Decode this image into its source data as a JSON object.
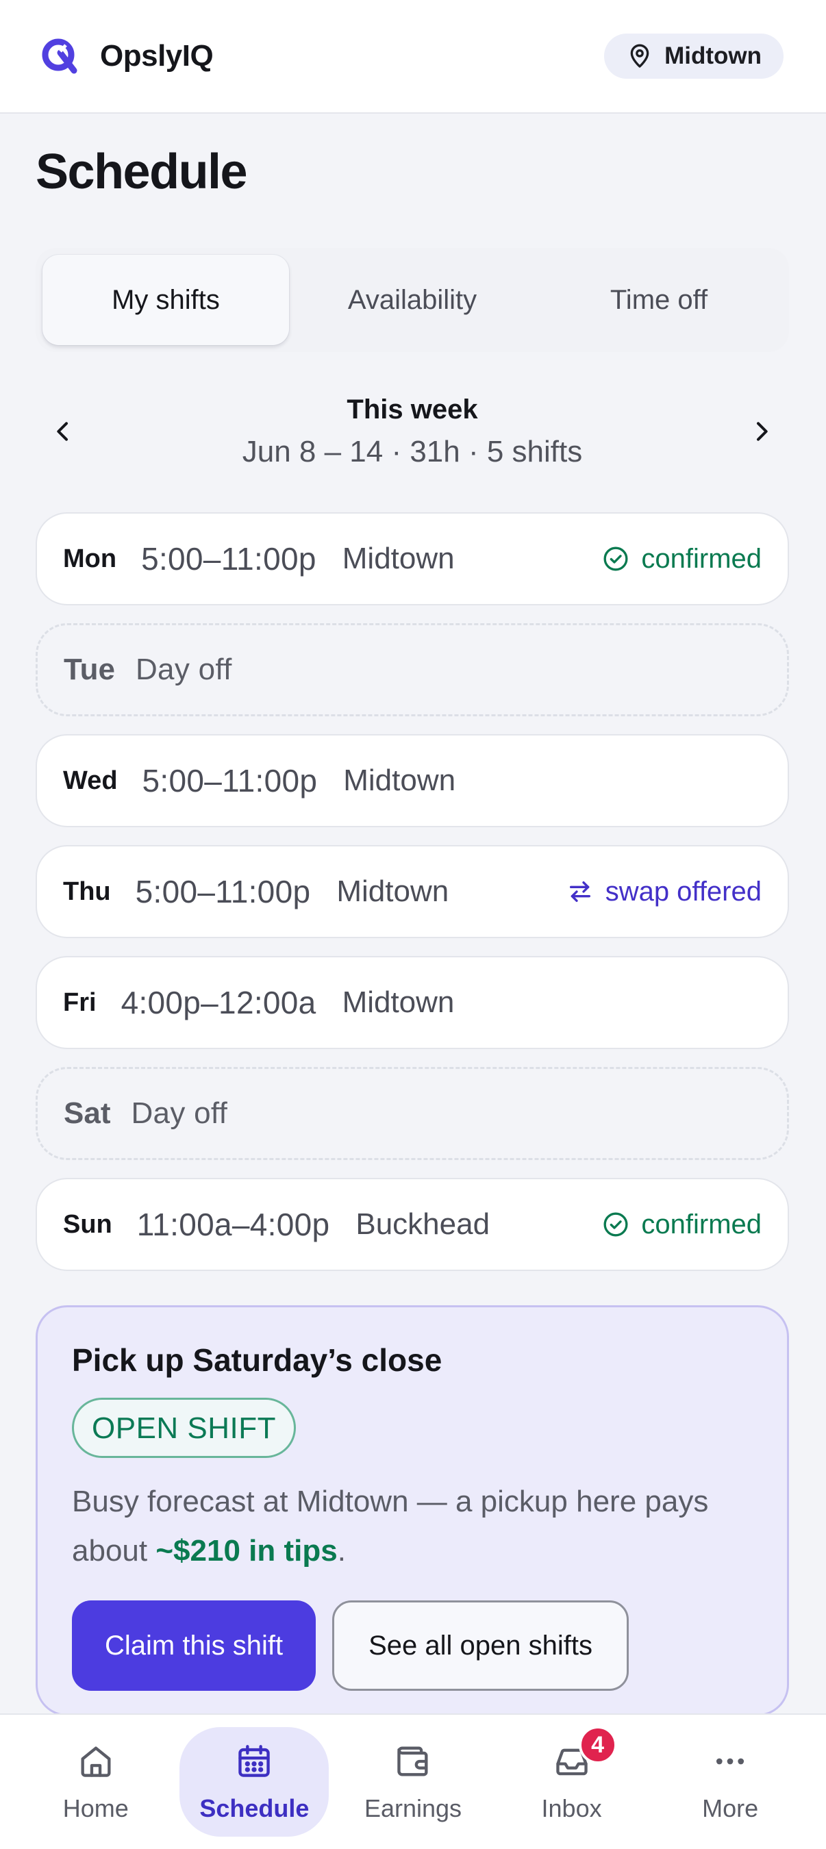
{
  "app": {
    "brand_name": "OpslyIQ",
    "location": "Midtown",
    "accent": "#4c3ce0"
  },
  "page": {
    "title": "Schedule"
  },
  "tabs": [
    {
      "label": "My shifts",
      "active": true
    },
    {
      "label": "Availability",
      "active": false
    },
    {
      "label": "Time off",
      "active": false
    }
  ],
  "week": {
    "title": "This week",
    "summary": "Jun 8 – 14 · 31h · 5 shifts",
    "prev_icon": "chevron-left-icon",
    "next_icon": "chevron-right-icon"
  },
  "shifts": [
    {
      "day": "Mon",
      "time": "5:00–11:00p",
      "location": "Midtown",
      "status": "confirmed",
      "status_icon": "check-circle-icon",
      "status_color": "#0a7a50"
    },
    {
      "day": "Tue",
      "time": "Day off",
      "location": "",
      "status": "",
      "off": true
    },
    {
      "day": "Wed",
      "time": "5:00–11:00p",
      "location": "Midtown",
      "status": ""
    },
    {
      "day": "Thu",
      "time": "5:00–11:00p",
      "location": "Midtown",
      "status": "swap offered",
      "status_icon": "swap-icon",
      "status_color": "#4330c8"
    },
    {
      "day": "Fri",
      "time": "4:00p–12:00a",
      "location": "Midtown",
      "status": ""
    },
    {
      "day": "Sat",
      "time": "Day off",
      "location": "",
      "status": "",
      "off": true
    },
    {
      "day": "Sun",
      "time": "11:00a–4:00p",
      "location": "Buckhead",
      "status": "confirmed",
      "status_icon": "check-circle-icon",
      "status_color": "#0a7a50"
    }
  ],
  "open_shift": {
    "title": "Pick up Saturday’s close",
    "badge": "OPEN SHIFT",
    "desc_prefix": "Busy forecast at Midtown — a pickup here pays about ",
    "desc_highlight": "~$210 in tips",
    "desc_suffix": ".",
    "primary_label": "Claim this shift",
    "secondary_label": "See all open shifts"
  },
  "bottom_nav": [
    {
      "label": "Home",
      "icon": "home-icon",
      "active": false
    },
    {
      "label": "Schedule",
      "icon": "calendar-icon",
      "active": true
    },
    {
      "label": "Earnings",
      "icon": "wallet-icon",
      "active": false
    },
    {
      "label": "Inbox",
      "icon": "inbox-icon",
      "active": false,
      "badge": "4"
    },
    {
      "label": "More",
      "icon": "more-icon",
      "active": false
    }
  ]
}
